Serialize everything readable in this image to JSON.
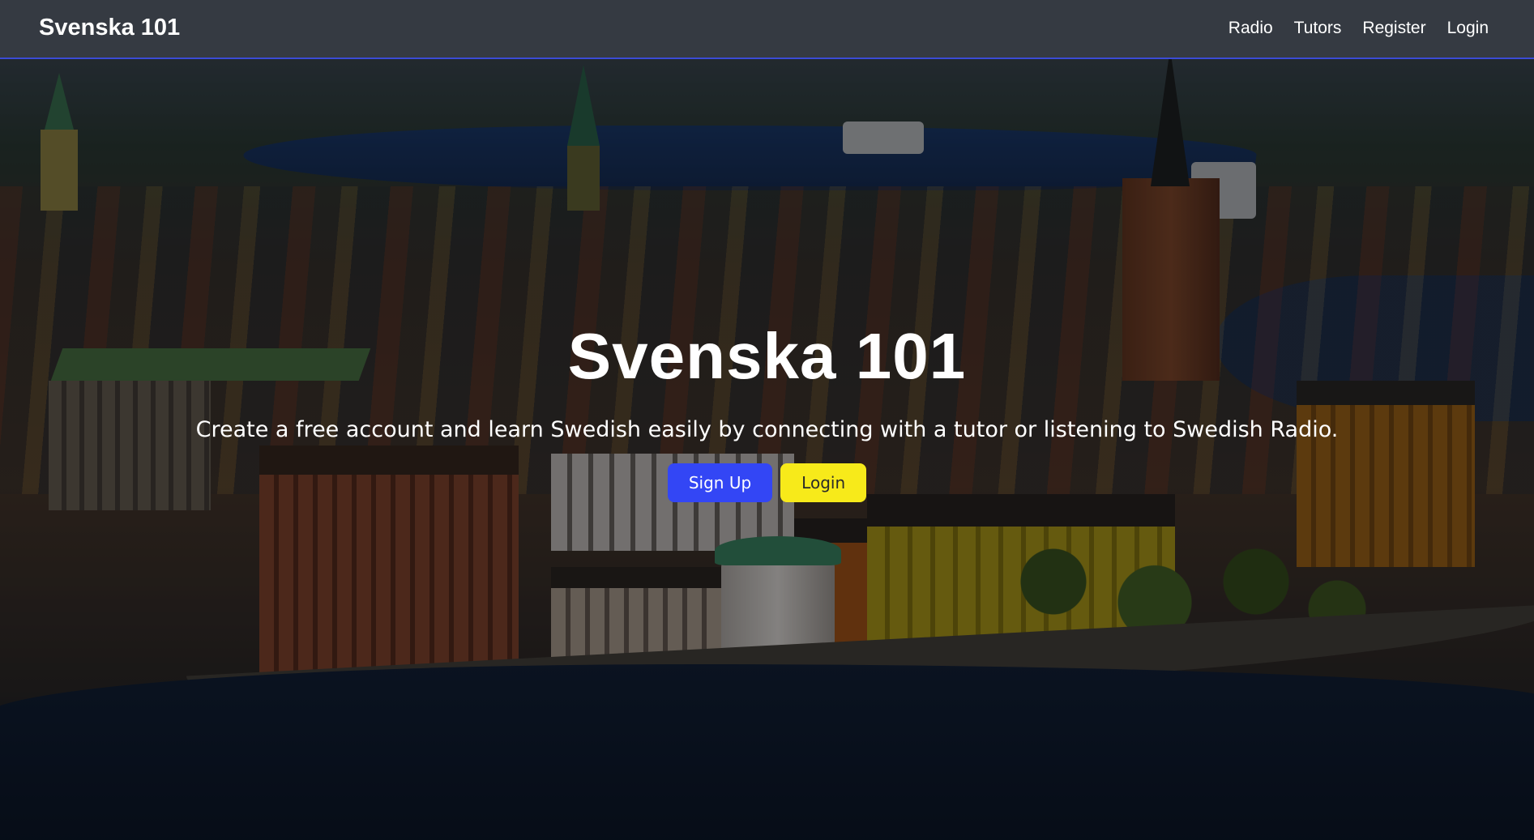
{
  "navbar": {
    "brand": "Svenska 101",
    "links": [
      {
        "label": "Radio"
      },
      {
        "label": "Tutors"
      },
      {
        "label": "Register"
      },
      {
        "label": "Login"
      }
    ]
  },
  "hero": {
    "background_image": "aerial-stockholm-city-photo",
    "title": "Svenska 101",
    "subtitle": "Create a free account and learn Swedish easily by connecting with a tutor or listening to Swedish Radio.",
    "buttons": {
      "signup_label": "Sign Up",
      "login_label": "Login"
    }
  },
  "colors": {
    "navbar_bg": "#353a42",
    "navbar_border": "#3b4bd6",
    "signup_button": "#3346f5",
    "login_button": "#f7ea1a",
    "text": "#ffffff"
  }
}
